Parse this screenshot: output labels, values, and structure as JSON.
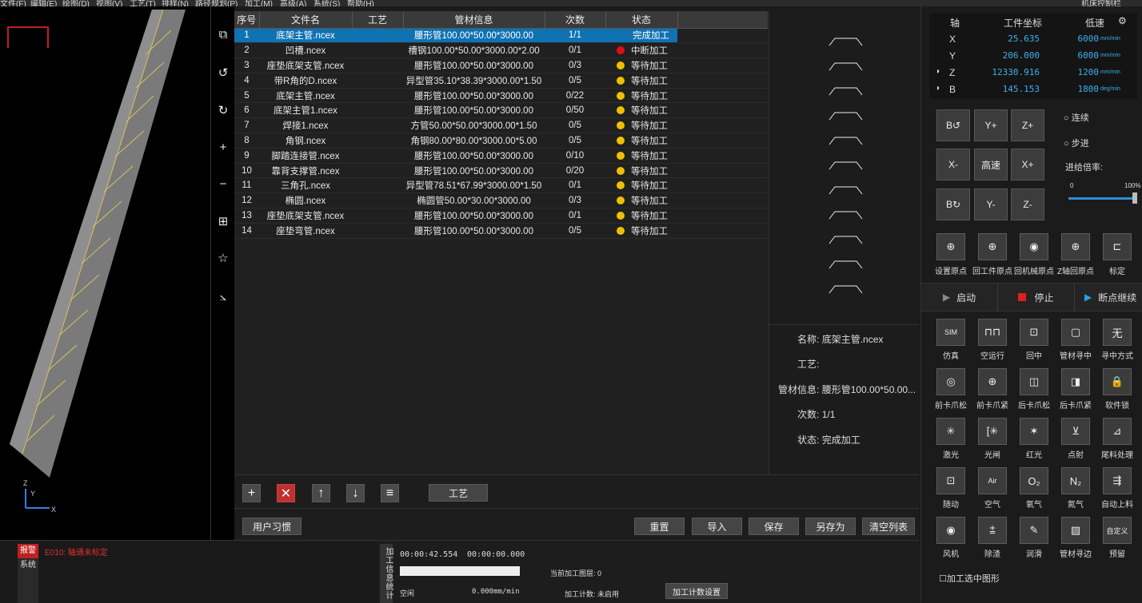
{
  "menubar": {
    "items": [
      "文件(F)",
      "编辑(E)",
      "绘图(D)",
      "视图(V)",
      "工艺(T)",
      "排样(N)",
      "路径规划(P)",
      "加工(M)",
      "高级(A)",
      "系统(S)",
      "帮助(H)"
    ],
    "right_label": "机床控制栏"
  },
  "viewport": {
    "axis_x": "X",
    "axis_y": "Y",
    "axis_z": "Z"
  },
  "vtoolbar": {
    "icons": [
      "view-cube-icon",
      "rotate-ccw-icon",
      "rotate-cw-icon",
      "zoom-in-icon",
      "zoom-out-icon",
      "fit-view-icon",
      "star-icon",
      "measure-icon"
    ]
  },
  "file_table": {
    "headers": [
      "序号",
      "文件名",
      "工艺",
      "管材信息",
      "次数",
      "状态"
    ],
    "rows": [
      {
        "no": "1",
        "name": "底架主管.ncex",
        "process": "",
        "tube": "腰形管100.00*50.00*3000.00",
        "count": "1/1",
        "status": "完成加工",
        "dot": "#0f72b3",
        "selected": true
      },
      {
        "no": "2",
        "name": "凹槽.ncex",
        "process": "",
        "tube": "槽钢100.00*50.00*3000.00*2.00",
        "count": "0/1",
        "status": "中断加工",
        "dot": "#e01010",
        "selected": false
      },
      {
        "no": "3",
        "name": "座垫底架支管.ncex",
        "process": "",
        "tube": "腰形管100.00*50.00*3000.00",
        "count": "0/3",
        "status": "等待加工",
        "dot": "#f0c000",
        "selected": false
      },
      {
        "no": "4",
        "name": "带R角的D.ncex",
        "process": "",
        "tube": "异型管35.10*38.39*3000.00*1.50",
        "count": "0/5",
        "status": "等待加工",
        "dot": "#f0c000",
        "selected": false
      },
      {
        "no": "5",
        "name": "底架主管.ncex",
        "process": "",
        "tube": "腰形管100.00*50.00*3000.00",
        "count": "0/22",
        "status": "等待加工",
        "dot": "#f0c000",
        "selected": false
      },
      {
        "no": "6",
        "name": "底架主管1.ncex",
        "process": "",
        "tube": "腰形管100.00*50.00*3000.00",
        "count": "0/50",
        "status": "等待加工",
        "dot": "#f0c000",
        "selected": false
      },
      {
        "no": "7",
        "name": "焊接1.ncex",
        "process": "",
        "tube": "方管50.00*50.00*3000.00*1.50",
        "count": "0/5",
        "status": "等待加工",
        "dot": "#f0c000",
        "selected": false
      },
      {
        "no": "8",
        "name": "角钢.ncex",
        "process": "",
        "tube": "角钢80.00*80.00*3000.00*5.00",
        "count": "0/5",
        "status": "等待加工",
        "dot": "#f0c000",
        "selected": false
      },
      {
        "no": "9",
        "name": "脚踏连接管.ncex",
        "process": "",
        "tube": "腰形管100.00*50.00*3000.00",
        "count": "0/10",
        "status": "等待加工",
        "dot": "#f0c000",
        "selected": false
      },
      {
        "no": "10",
        "name": "靠背支撑管.ncex",
        "process": "",
        "tube": "腰形管100.00*50.00*3000.00",
        "count": "0/20",
        "status": "等待加工",
        "dot": "#f0c000",
        "selected": false
      },
      {
        "no": "11",
        "name": "三角孔.ncex",
        "process": "",
        "tube": "异型管78.51*67.99*3000.00*1.50",
        "count": "0/1",
        "status": "等待加工",
        "dot": "#f0c000",
        "selected": false
      },
      {
        "no": "12",
        "name": "椭圆.ncex",
        "process": "",
        "tube": "椭圆管50.00*30.00*3000.00",
        "count": "0/3",
        "status": "等待加工",
        "dot": "#f0c000",
        "selected": false
      },
      {
        "no": "13",
        "name": "座垫底架支管.ncex",
        "process": "",
        "tube": "腰形管100.00*50.00*3000.00",
        "count": "0/1",
        "status": "等待加工",
        "dot": "#f0c000",
        "selected": false
      },
      {
        "no": "14",
        "name": "座垫弯管.ncex",
        "process": "",
        "tube": "腰形管100.00*50.00*3000.00",
        "count": "0/5",
        "status": "等待加工",
        "dot": "#f0c000",
        "selected": false
      }
    ]
  },
  "info": {
    "name_label": "名称:",
    "name_value": "底架主管.ncex",
    "process_label": "工艺:",
    "process_value": "",
    "tube_label": "管材信息:",
    "tube_value": "腰形管100.00*50.00...",
    "count_label": "次数:",
    "count_value": "1/1",
    "status_label": "状态:",
    "status_value": "完成加工"
  },
  "table_toolbar": {
    "add_icon": "+",
    "delete_icon": "✕",
    "up_icon": "↑",
    "down_icon": "↓",
    "sort_icon": "≡",
    "process_button": "工艺"
  },
  "bottom_buttons": {
    "user_habit": "用户习惯",
    "reset": "重置",
    "import": "导入",
    "save": "保存",
    "save_as": "另存为",
    "clear_list": "清空列表"
  },
  "log": {
    "tab_alarm": "报警",
    "tab_system": "系统",
    "message": "E010: 轴通未标定"
  },
  "stats": {
    "tab_label": "加工信息统计",
    "time_total": "00:00:42.554",
    "time_current": "00:00:00.000",
    "current_layer_label": "当前加工图层:",
    "current_layer_value": "0",
    "state": "空闲",
    "speed": "0.000mm/min",
    "count_label": "加工计数:",
    "count_value": "未启用",
    "count_settings_button": "加工计数设置"
  },
  "axis_panel": {
    "header_axis": "轴",
    "header_coord": "工件坐标",
    "header_speed": "低速",
    "rows": [
      {
        "axis": "X",
        "value": "25.635",
        "speed": "6000",
        "unit": "mm/min"
      },
      {
        "axis": "Y",
        "value": "206.000",
        "speed": "6000",
        "unit": "mm/min"
      },
      {
        "axis": "Z",
        "value": "12330.916",
        "speed": "1200",
        "unit": "mm/min"
      },
      {
        "axis": "B",
        "value": "145.153",
        "speed": "1800",
        "unit": "deg/min"
      }
    ]
  },
  "jog": {
    "b_ccw": "B↺",
    "y_plus": "Y+",
    "z_plus": "Z+",
    "x_minus": "X-",
    "high_speed": "高速",
    "x_plus": "X+",
    "b_cw": "B↻",
    "y_minus": "Y-",
    "z_minus": "Z-",
    "mode_continuous": "连续",
    "mode_step": "步进",
    "feed_rate_label": "进给倍率:",
    "feed_min": "0",
    "feed_max": "100%",
    "feed_value_percent": 100
  },
  "origin_buttons": [
    "设置原点",
    "回工件原点",
    "回机械原点",
    "Z轴回原点",
    "标定"
  ],
  "run_bar": {
    "start": "启动",
    "stop": "停止",
    "breakpoint": "断点继续"
  },
  "function_buttons": [
    {
      "icon": "SIM",
      "label": "仿真"
    },
    {
      "icon": "⊓⊓",
      "label": "空运行"
    },
    {
      "icon": "⊡",
      "label": "回中"
    },
    {
      "icon": "▢",
      "label": "管材寻中"
    },
    {
      "icon": "无",
      "label": "寻中方式"
    },
    {
      "icon": "◎",
      "label": "前卡爪松"
    },
    {
      "icon": "⊕",
      "label": "前卡爪紧"
    },
    {
      "icon": "◫",
      "label": "后卡爪松"
    },
    {
      "icon": "◨",
      "label": "后卡爪紧"
    },
    {
      "icon": "🔒",
      "label": "软件锁"
    },
    {
      "icon": "✳",
      "label": "激光"
    },
    {
      "icon": "[✳",
      "label": "光闸"
    },
    {
      "icon": "✶",
      "label": "红光"
    },
    {
      "icon": "⊻",
      "label": "点射"
    },
    {
      "icon": "⊿",
      "label": "尾料处理"
    },
    {
      "icon": "⊡",
      "label": "随动"
    },
    {
      "icon": "Air",
      "label": "空气"
    },
    {
      "icon": "O₂",
      "label": "氧气"
    },
    {
      "icon": "N₂",
      "label": "氮气"
    },
    {
      "icon": "⇶",
      "label": "自动上料"
    },
    {
      "icon": "◉",
      "label": "风机"
    },
    {
      "icon": "⩲",
      "label": "除渣"
    },
    {
      "icon": "✎",
      "label": "润滑"
    },
    {
      "icon": "▨",
      "label": "管材寻边"
    },
    {
      "icon": "自定义",
      "label": "预留"
    }
  ],
  "checkbox_label": "加工选中图形"
}
